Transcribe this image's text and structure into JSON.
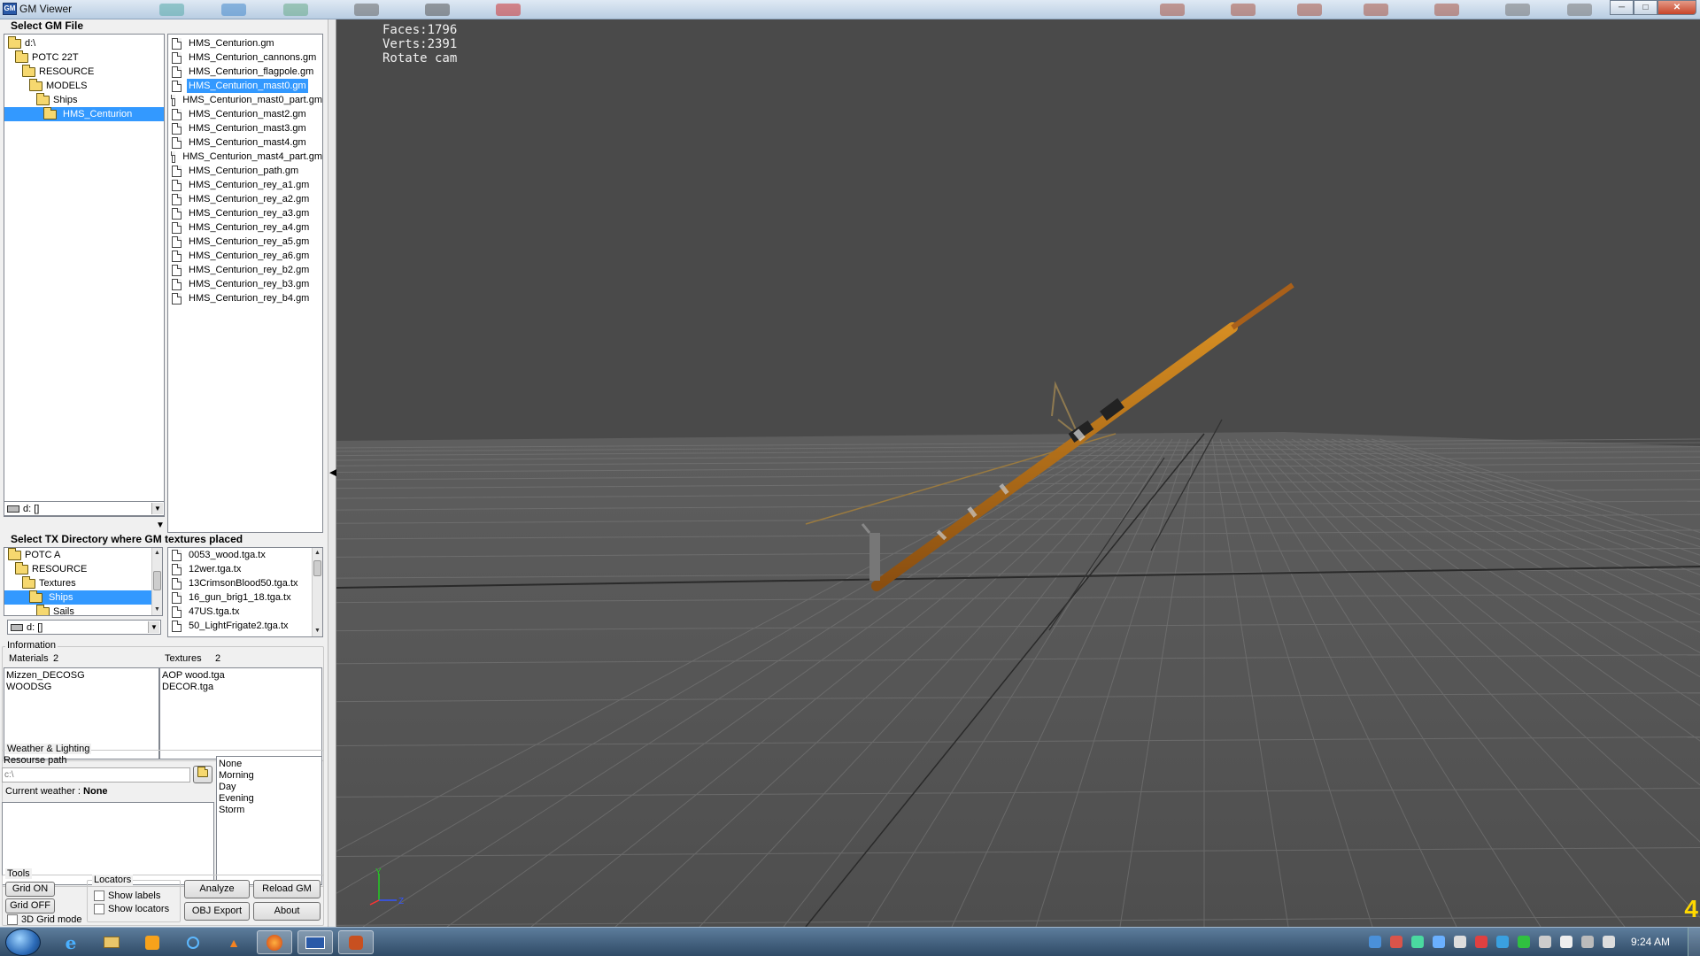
{
  "window": {
    "title": "GM Viewer",
    "minimize": "─",
    "maximize": "□",
    "close": "✕"
  },
  "gm_section": {
    "title": "Select GM File",
    "tree": [
      {
        "label": "d:\\",
        "indent": 0,
        "selected": false
      },
      {
        "label": "POTC 22T",
        "indent": 1,
        "selected": false
      },
      {
        "label": "RESOURCE",
        "indent": 2,
        "selected": false
      },
      {
        "label": "MODELS",
        "indent": 3,
        "selected": false
      },
      {
        "label": "Ships",
        "indent": 4,
        "selected": false
      },
      {
        "label": "HMS_Centurion",
        "indent": 5,
        "selected": true
      }
    ],
    "drive": "d: []",
    "files": [
      {
        "name": "HMS_Centurion.gm",
        "selected": false
      },
      {
        "name": "HMS_Centurion_cannons.gm",
        "selected": false
      },
      {
        "name": "HMS_Centurion_flagpole.gm",
        "selected": false
      },
      {
        "name": "HMS_Centurion_mast0.gm",
        "selected": true
      },
      {
        "name": "HMS_Centurion_mast0_part.gm",
        "selected": false
      },
      {
        "name": "HMS_Centurion_mast2.gm",
        "selected": false
      },
      {
        "name": "HMS_Centurion_mast3.gm",
        "selected": false
      },
      {
        "name": "HMS_Centurion_mast4.gm",
        "selected": false
      },
      {
        "name": "HMS_Centurion_mast4_part.gm",
        "selected": false
      },
      {
        "name": "HMS_Centurion_path.gm",
        "selected": false
      },
      {
        "name": "HMS_Centurion_rey_a1.gm",
        "selected": false
      },
      {
        "name": "HMS_Centurion_rey_a2.gm",
        "selected": false
      },
      {
        "name": "HMS_Centurion_rey_a3.gm",
        "selected": false
      },
      {
        "name": "HMS_Centurion_rey_a4.gm",
        "selected": false
      },
      {
        "name": "HMS_Centurion_rey_a5.gm",
        "selected": false
      },
      {
        "name": "HMS_Centurion_rey_a6.gm",
        "selected": false
      },
      {
        "name": "HMS_Centurion_rey_b2.gm",
        "selected": false
      },
      {
        "name": "HMS_Centurion_rey_b3.gm",
        "selected": false
      },
      {
        "name": "HMS_Centurion_rey_b4.gm",
        "selected": false
      }
    ]
  },
  "tx_section": {
    "title": "Select TX Directory where GM textures placed",
    "tree": [
      {
        "label": "POTC A",
        "indent": 0,
        "selected": false
      },
      {
        "label": "RESOURCE",
        "indent": 1,
        "selected": false
      },
      {
        "label": "Textures",
        "indent": 2,
        "selected": false
      },
      {
        "label": "Ships",
        "indent": 3,
        "selected": true
      },
      {
        "label": "Sails",
        "indent": 4,
        "selected": false
      }
    ],
    "drive": "d: []",
    "files": [
      "0053_wood.tga.tx",
      "12wer.tga.tx",
      "13CrimsonBlood50.tga.tx",
      "16_gun_brig1_18.tga.tx",
      "47US.tga.tx",
      "50_LightFrigate2.tga.tx"
    ]
  },
  "information": {
    "title": "Information",
    "materials_label": "Materials",
    "materials_count": "2",
    "textures_label": "Textures",
    "textures_count": "2",
    "materials": [
      "Mizzen_DECOSG",
      "WOODSG"
    ],
    "textures": [
      "AOP wood.tga",
      "DECOR.tga"
    ]
  },
  "weather": {
    "title": "Weather & Lighting",
    "resource_label": "Resourse path",
    "resource_placeholder": "c:\\",
    "current_label": "Current weather :",
    "current_value": "None",
    "options": [
      "None",
      "Morning",
      "Day",
      "Evening",
      "Storm"
    ]
  },
  "tools": {
    "title": "Tools",
    "grid_on": "Grid ON",
    "grid_off": "Grid OFF",
    "grid3d": "3D Grid mode",
    "locators_title": "Locators",
    "show_labels": "Show labels",
    "show_locators": "Show locators",
    "analyze": "Analyze",
    "reload": "Reload GM",
    "obj_export": "OBJ Export",
    "about": "About"
  },
  "viewport": {
    "faces_line": "Faces:1796",
    "verts_line": "Verts:2391",
    "mode_line": "Rotate cam",
    "corner_digit": "4",
    "axis_y": "Y",
    "axis_z": "Z"
  },
  "taskbar": {
    "clock": "9:24 AM",
    "icons": [
      "ie-icon",
      "explorer-icon",
      "media-player-icon",
      "search-icon",
      "vlc-icon",
      "firefox-icon",
      "gm-viewer-icon",
      "tool-icon"
    ]
  }
}
